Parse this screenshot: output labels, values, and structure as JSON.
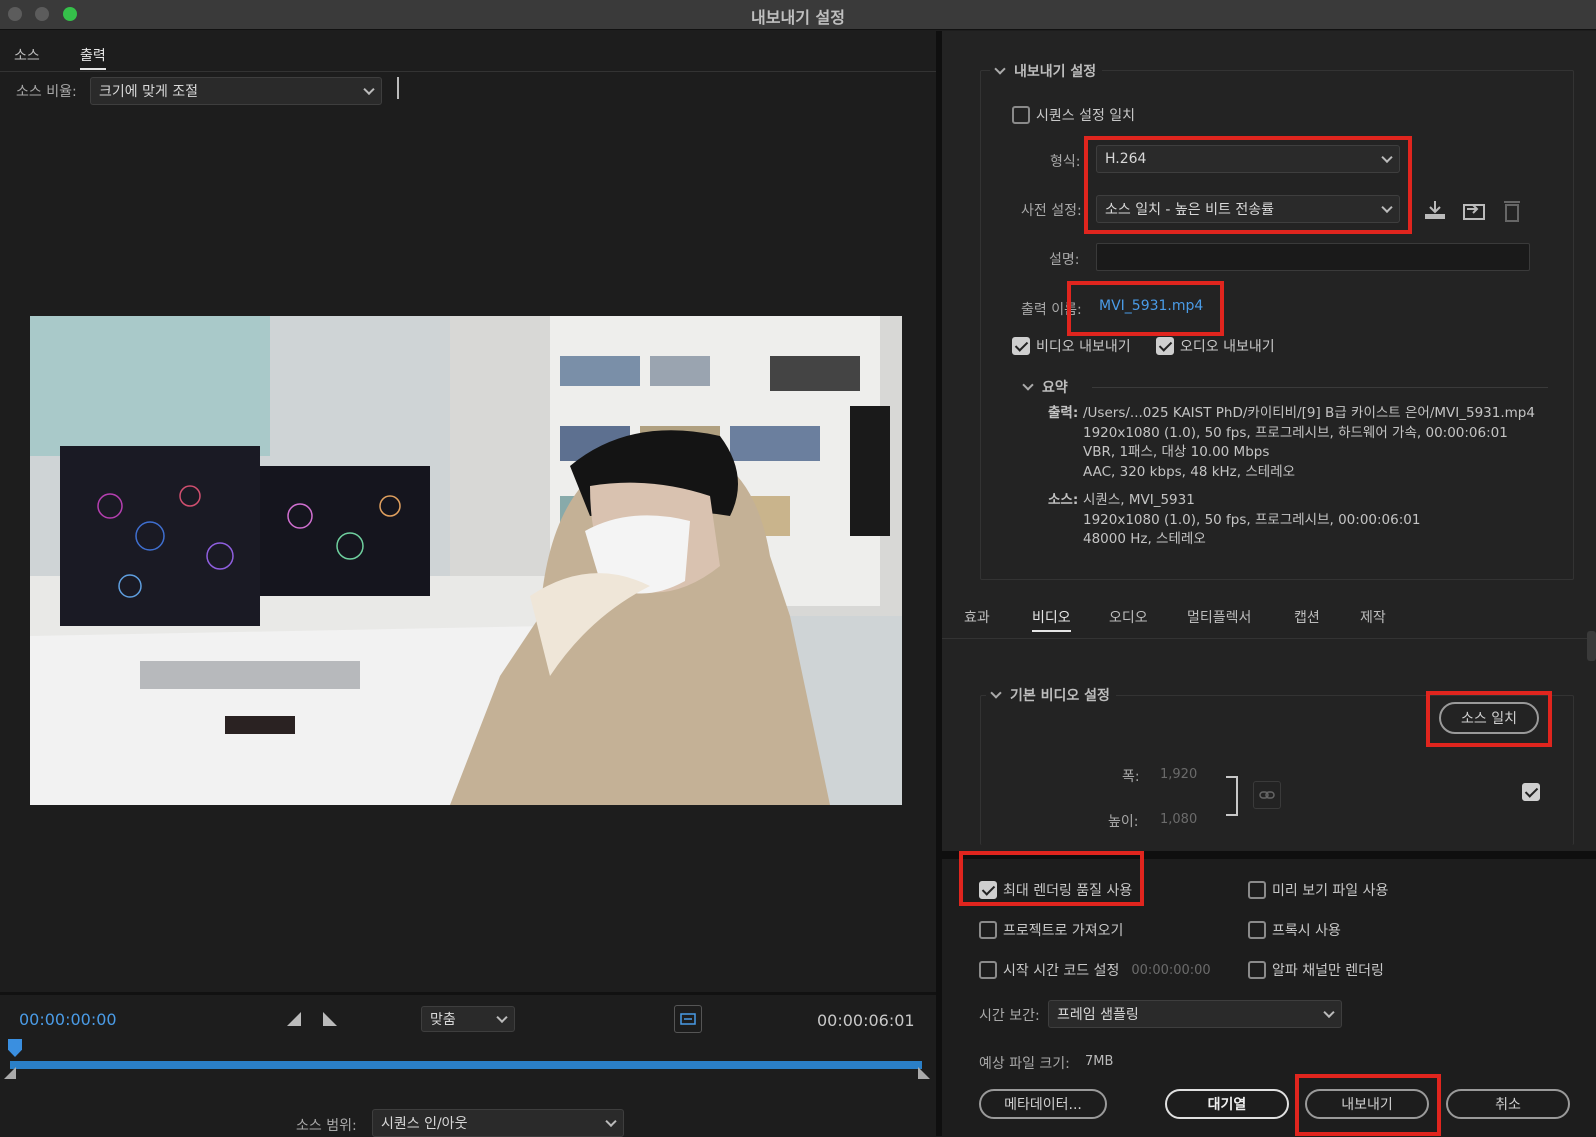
{
  "window": {
    "title": "내보내기 설정"
  },
  "left": {
    "tabs": [
      {
        "label": "소스"
      },
      {
        "label": "출력"
      }
    ],
    "source_scale": {
      "label": "소스 비율:",
      "value": "크기에 맞게 조절"
    },
    "preview_image": "office-scene-person-with-mask",
    "timeline": {
      "current": "00:00:00:00",
      "fit": "맞춤",
      "duration": "00:00:06:01",
      "range_label": "소스 범위:",
      "range_value": "시퀀스 인/아웃"
    }
  },
  "export": {
    "section_title": "내보내기 설정",
    "match_sequence": {
      "label": "시퀀스 설정 일치",
      "checked": false
    },
    "format": {
      "label": "형식:",
      "value": "H.264"
    },
    "preset": {
      "label": "사전 설정:",
      "value": "소스 일치 - 높은 비트 전송률"
    },
    "comments_label": "설명:",
    "output_name": {
      "label": "출력 이름:",
      "value": "MVI_5931.mp4"
    },
    "export_video": {
      "label": "비디오 내보내기",
      "checked": true
    },
    "export_audio": {
      "label": "오디오 내보내기",
      "checked": true
    },
    "summary": {
      "title": "요약",
      "output_label": "출력:",
      "output_lines": [
        "/Users/...025 KAIST PhD/카이티비/[9] B급 카이스트 은어/MVI_5931.mp4",
        "1920x1080 (1.0), 50 fps, 프로그레시브, 하드웨어 가속, 00:00:06:01",
        "VBR, 1패스, 대상 10.00 Mbps",
        "AAC, 320 kbps, 48 kHz, 스테레오"
      ],
      "source_label": "소스:",
      "source_lines": [
        "시퀀스, MVI_5931",
        "1920x1080 (1.0), 50 fps, 프로그레시브, 00:00:06:01",
        "48000 Hz, 스테레오"
      ]
    }
  },
  "settings_tabs": [
    {
      "label": "효과"
    },
    {
      "label": "비디오"
    },
    {
      "label": "오디오"
    },
    {
      "label": "멀티플렉서"
    },
    {
      "label": "캡션"
    },
    {
      "label": "제작"
    }
  ],
  "video": {
    "section_title": "기본 비디오 설정",
    "match_source": "소스 일치",
    "width_label": "폭:",
    "width_value": "1,920",
    "height_label": "높이:",
    "height_value": "1,080"
  },
  "options": {
    "max_render": {
      "label": "최대 렌더링 품질 사용",
      "checked": true
    },
    "use_previews": {
      "label": "미리 보기 파일 사용",
      "checked": false
    },
    "import_project": {
      "label": "프로젝트로 가져오기",
      "checked": false
    },
    "use_proxies": {
      "label": "프록시 사용",
      "checked": false
    },
    "start_timecode": {
      "label": "시작 시간 코드 설정",
      "checked": false,
      "value": "00:00:00:00"
    },
    "alpha_only": {
      "label": "알파 채널만 렌더링",
      "checked": false
    },
    "time_interp": {
      "label": "시간 보간:",
      "value": "프레임 샘플링"
    },
    "file_size": {
      "label": "예상 파일 크기:",
      "value": "7MB"
    }
  },
  "buttons": {
    "metadata": "메타데이터...",
    "queue": "대기열",
    "export": "내보내기",
    "cancel": "취소"
  }
}
